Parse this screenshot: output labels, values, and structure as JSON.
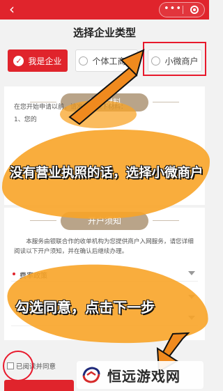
{
  "header": {
    "back_icon": "chevron-left-icon",
    "more_icon": "more-dots-icon",
    "close_icon": "target-close-icon",
    "more_label": "•••"
  },
  "title": "选择企业类型",
  "merchant_types": {
    "enterprise": {
      "label": "我是企业",
      "selected": true
    },
    "individual": {
      "label": "个体工商户",
      "selected": false
    },
    "micro": {
      "label": "小微商户",
      "selected": false
    }
  },
  "materials": {
    "pill_label": "备的材料",
    "intro": "在您开始申请以前，请准备好以下材料：",
    "item1": "1、您的"
  },
  "notice": {
    "pill_label": "开户须知",
    "text": "本服务由银联合作的收单机构为您提供商户入网服务，请您详细阅读以下开户须知，并在确认后继续办理。",
    "rows": [
      {
        "label": "费率政策"
      },
      {
        "label": ""
      },
      {
        "label": ""
      }
    ]
  },
  "agreement": {
    "label": "已阅读并同意",
    "checked": false
  },
  "overlay": {
    "tip1": "没有营业执照的话，选择小微商户",
    "tip2": "勾选同意，点击下一步"
  },
  "watermark": {
    "text": "恒远游戏网"
  },
  "colors": {
    "brand_red": "#e0242c",
    "annotation_red": "#e8192c",
    "splash_orange": "#f8a428",
    "pill_tan": "#b9a489"
  }
}
